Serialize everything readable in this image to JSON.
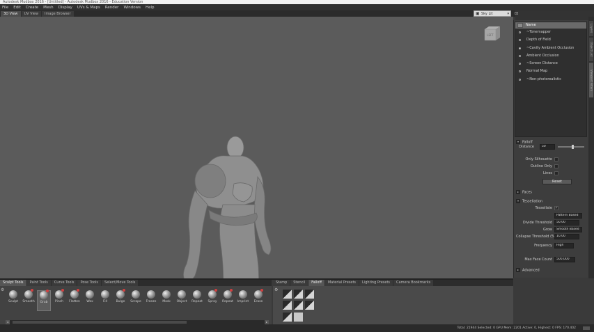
{
  "window": {
    "title": "Autodesk Mudbox 2016 - [Untitled] - Autodesk Mudbox 2016 - Education Version"
  },
  "menu": [
    "File",
    "Edit",
    "Create",
    "Mesh",
    "Display",
    "UVs & Maps",
    "Render",
    "Windows",
    "Help"
  ],
  "view_tabs": [
    {
      "label": "3D View",
      "active": true
    },
    {
      "label": "UV View",
      "active": false
    },
    {
      "label": "Image Browser",
      "active": false
    }
  ],
  "viewport": {
    "camera_select": "Sky Lit",
    "view_cube_label": "LEFT"
  },
  "side_tabs": [
    "Layers",
    "Object List",
    "Viewport Filters"
  ],
  "viewport_filters": {
    "header": "Name",
    "items": [
      {
        "label": "~Tonemapper",
        "on": false
      },
      {
        "label": "Depth of Field",
        "on": false
      },
      {
        "label": "~Cavity Ambient Occlusion",
        "on": true
      },
      {
        "label": "Ambient Occlusion",
        "on": false
      },
      {
        "label": "~Screen Distance",
        "on": false
      },
      {
        "label": "Normal Map",
        "on": false
      },
      {
        "label": "~Non-photorealistic",
        "on": false
      }
    ]
  },
  "properties": {
    "section_top": "Falloff",
    "distance_label": "Distance",
    "distance_value": "50",
    "only_silhouette_label": "Only Silhouette",
    "outline_only_label": "Outline Only",
    "lines_label": "Lines",
    "reset_label": "Reset",
    "faces_section": "Faces",
    "tessellation_section": "Tessellation",
    "tessellate_label": "Tessellate",
    "mode_value": "Pattern Based",
    "divide_threshold_label": "Divide Threshold",
    "divide_threshold_value": "50.00",
    "grow_label": "Grow",
    "grow_value": "Smooth Based",
    "collapse_threshold_label": "Collapse Threshold (%)",
    "collapse_threshold_value": "10.00",
    "frequency_label": "Frequency",
    "frequency_value": "High",
    "max_face_count_label": "Max Face Count",
    "max_face_count_value": "500,000",
    "advanced_section": "Advanced"
  },
  "tool_tabs": [
    {
      "label": "Sculpt Tools",
      "active": true
    },
    {
      "label": "Paint Tools",
      "active": false
    },
    {
      "label": "Curve Tools",
      "active": false
    },
    {
      "label": "Pose Tools",
      "active": false
    },
    {
      "label": "Select/Move Tools",
      "active": false
    }
  ],
  "tools": [
    {
      "label": "Sculpt",
      "active": false
    },
    {
      "label": "Smooth",
      "active": false
    },
    {
      "label": "Grab",
      "active": true
    },
    {
      "label": "Pinch",
      "active": false
    },
    {
      "label": "Flatten",
      "active": false
    },
    {
      "label": "Wax",
      "active": false
    },
    {
      "label": "Fill",
      "active": false
    },
    {
      "label": "Bulge",
      "active": false
    },
    {
      "label": "Scrape",
      "active": false
    },
    {
      "label": "Freeze",
      "active": false
    },
    {
      "label": "Mask",
      "active": false
    },
    {
      "label": "Object",
      "active": false
    },
    {
      "label": "Repeat",
      "active": false
    },
    {
      "label": "Spray",
      "active": false
    },
    {
      "label": "Repeat",
      "active": false
    },
    {
      "label": "Imprint",
      "active": false
    },
    {
      "label": "Erase",
      "active": false
    }
  ],
  "stamp_tabs": [
    {
      "label": "Stamp",
      "active": false
    },
    {
      "label": "Stencil",
      "active": false
    },
    {
      "label": "Falloff",
      "active": true
    },
    {
      "label": "Material Presets",
      "active": false
    },
    {
      "label": "Lighting Presets",
      "active": false
    },
    {
      "label": "Camera Bookmarks",
      "active": false
    }
  ],
  "status": {
    "text": "Total: 21944  Selected: 0  GPU Mem: 2201  Active: 0, Highest: 0  FPS: 170.402"
  }
}
